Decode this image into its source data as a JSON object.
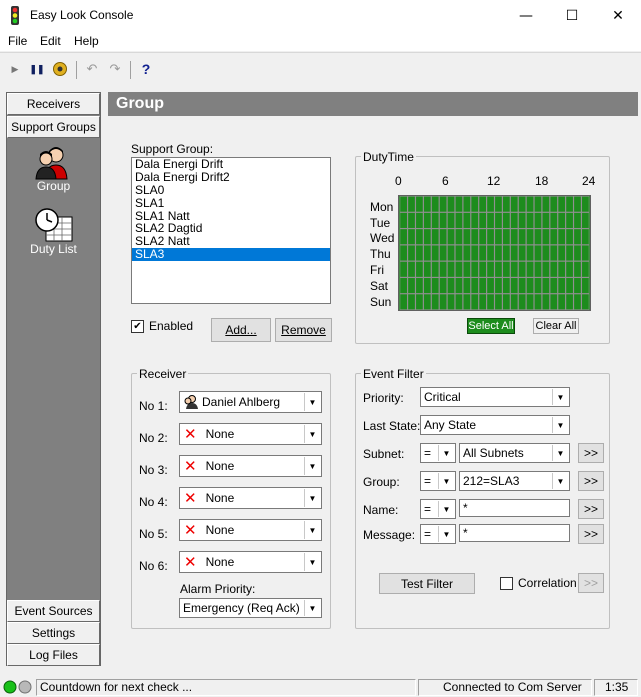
{
  "window": {
    "title": "Easy Look Console",
    "minimize": "—",
    "maximize": "☐",
    "close": "✕"
  },
  "menu": [
    "File",
    "Edit",
    "Help"
  ],
  "toolbar": {
    "play": "▶",
    "pause": "❚❚",
    "undo": "↶",
    "redo": "↷",
    "help": "?"
  },
  "sidebar": {
    "top_buttons": [
      "Receivers",
      "Support Groups"
    ],
    "items": [
      "Group",
      "Duty List"
    ],
    "bottom_buttons": [
      "Event Sources",
      "Settings",
      "Log Files"
    ]
  },
  "header": "Group",
  "support_group": {
    "label": "Support Group:",
    "items": [
      "Dala Energi Drift",
      "Dala Energi Drift2",
      "SLA0",
      "SLA1",
      "SLA1 Natt",
      "SLA2 Dagtid",
      "SLA2 Natt",
      "SLA3"
    ],
    "selected_index": 7,
    "enabled_label": "Enabled",
    "enabled": true,
    "add_label": "Add...",
    "remove_label": "Remove"
  },
  "dutytime": {
    "label": "DutyTime",
    "hours": [
      "0",
      "6",
      "12",
      "18",
      "24"
    ],
    "days": [
      "Mon",
      "Tue",
      "Wed",
      "Thu",
      "Fri",
      "Sat",
      "Sun"
    ],
    "select_all": "Select All",
    "clear_all": "Clear All",
    "color": "#1d8c1d"
  },
  "receiver": {
    "label": "Receiver",
    "rows": [
      {
        "label": "No 1:",
        "value": "Daniel Ahlberg",
        "icon": "user-icon"
      },
      {
        "label": "No 2:",
        "value": "None",
        "icon": "x-icon"
      },
      {
        "label": "No 3:",
        "value": "None",
        "icon": "x-icon"
      },
      {
        "label": "No 4:",
        "value": "None",
        "icon": "x-icon"
      },
      {
        "label": "No 5:",
        "value": "None",
        "icon": "x-icon"
      },
      {
        "label": "No 6:",
        "value": "None",
        "icon": "x-icon"
      }
    ],
    "alarm_priority_label": "Alarm Priority:",
    "alarm_priority": "Emergency (Req Ack)"
  },
  "event_filter": {
    "label": "Event Filter",
    "priority_label": "Priority:",
    "priority": "Critical",
    "last_state_label": "Last State:",
    "last_state": "Any State",
    "subnet_label": "Subnet:",
    "subnet_op": "=",
    "subnet": "All Subnets",
    "group_label": "Group:",
    "group_op": "=",
    "group": "212=SLA3",
    "name_label": "Name:",
    "name_op": "=",
    "name": "*",
    "message_label": "Message:",
    "message_op": "=",
    "message": "*",
    "more": ">>",
    "test_filter": "Test Filter",
    "correlation": "Correlation"
  },
  "status": {
    "countdown": "Countdown for next check ...",
    "connection": "Connected to Com Server",
    "time": "1:35"
  }
}
